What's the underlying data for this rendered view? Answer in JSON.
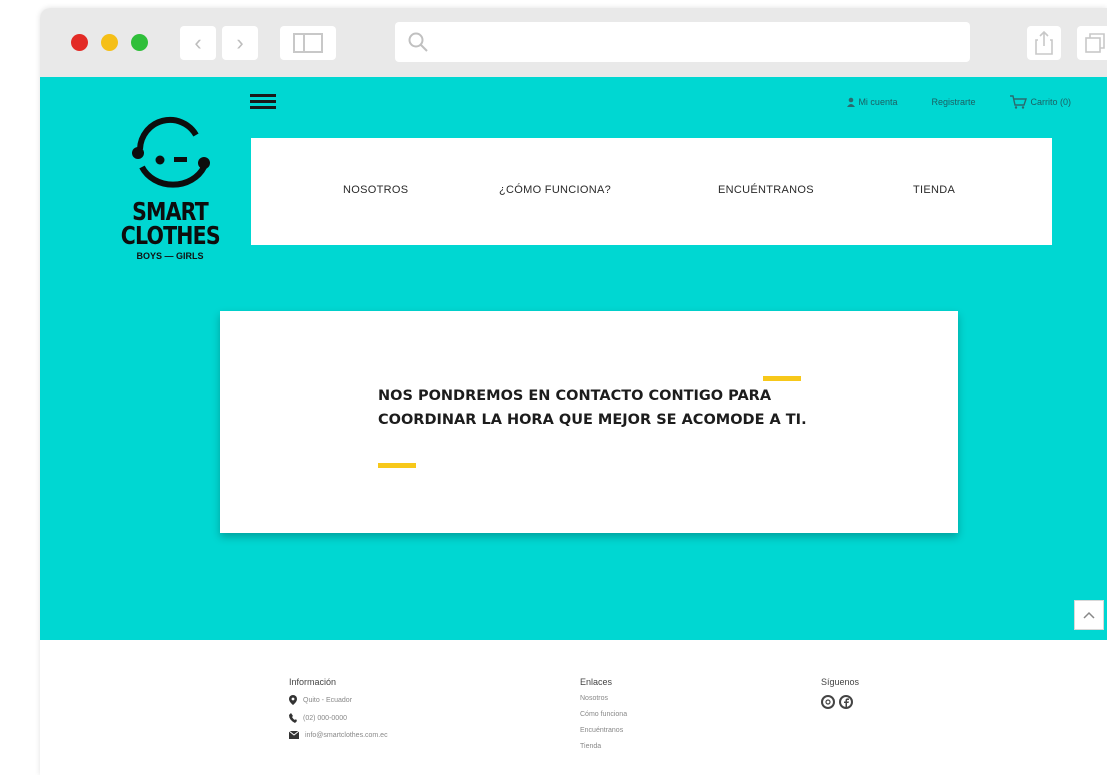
{
  "browser": {
    "back_glyph": "‹",
    "forward_glyph": "›",
    "address_value": ""
  },
  "header": {
    "links": {
      "account": "Mi cuenta",
      "register": "Registrarte",
      "cart": "Carrito (0)"
    }
  },
  "logo": {
    "word_1": "SMART",
    "word_2": "CLOTHES",
    "tagline": "BOYS — GIRLS"
  },
  "menu": {
    "items": [
      "NOSOTROS",
      "¿CÓMO FUNCIONA?",
      "ENCUÉNTRANOS",
      "TIENDA"
    ]
  },
  "message": {
    "text": "NOS PONDREMOS EN CONTACTO CONTIGO PARA COORDINAR LA HORA QUE MEJOR SE ACOMODE A TI."
  },
  "footer": {
    "info": {
      "title": "Información",
      "address": "Quito - Ecuador",
      "phone": "(02) 000-0000",
      "email": "info@smartclothes.com.ec"
    },
    "links": {
      "title": "Enlaces",
      "items": [
        "Nosotros",
        "Cómo funciona",
        "Encuéntranos",
        "Tienda"
      ]
    },
    "follow": {
      "title": "Síguenos"
    }
  },
  "colors": {
    "brand_teal": "#00d7d2",
    "accent_yellow": "#f7c81a"
  }
}
